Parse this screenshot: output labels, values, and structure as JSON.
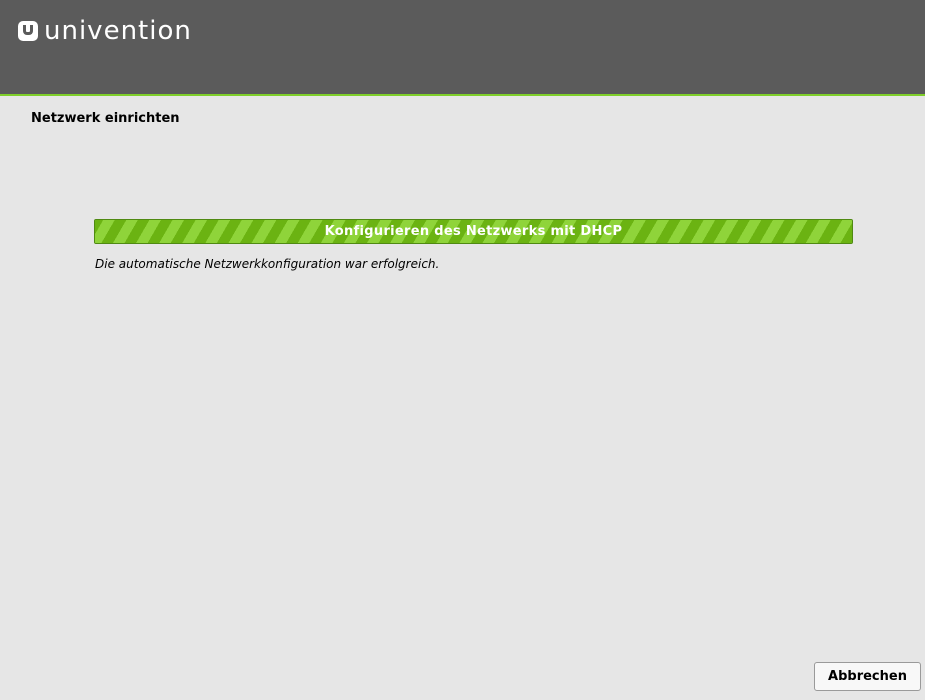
{
  "header": {
    "logo_text": "univention",
    "logo_icon": "univention-logo-icon",
    "background_color": "#5b5b5b",
    "accent_color": "#7fcf2a"
  },
  "page": {
    "title": "Netzwerk einrichten"
  },
  "progress": {
    "label": "Konfigurieren des Netzwerks mit DHCP",
    "value": 1.0,
    "status_text": "Die automatische Netzwerkkonfiguration war erfolgreich.",
    "bar_color": "#79c11e"
  },
  "footer": {
    "cancel_label": "Abbrechen"
  }
}
